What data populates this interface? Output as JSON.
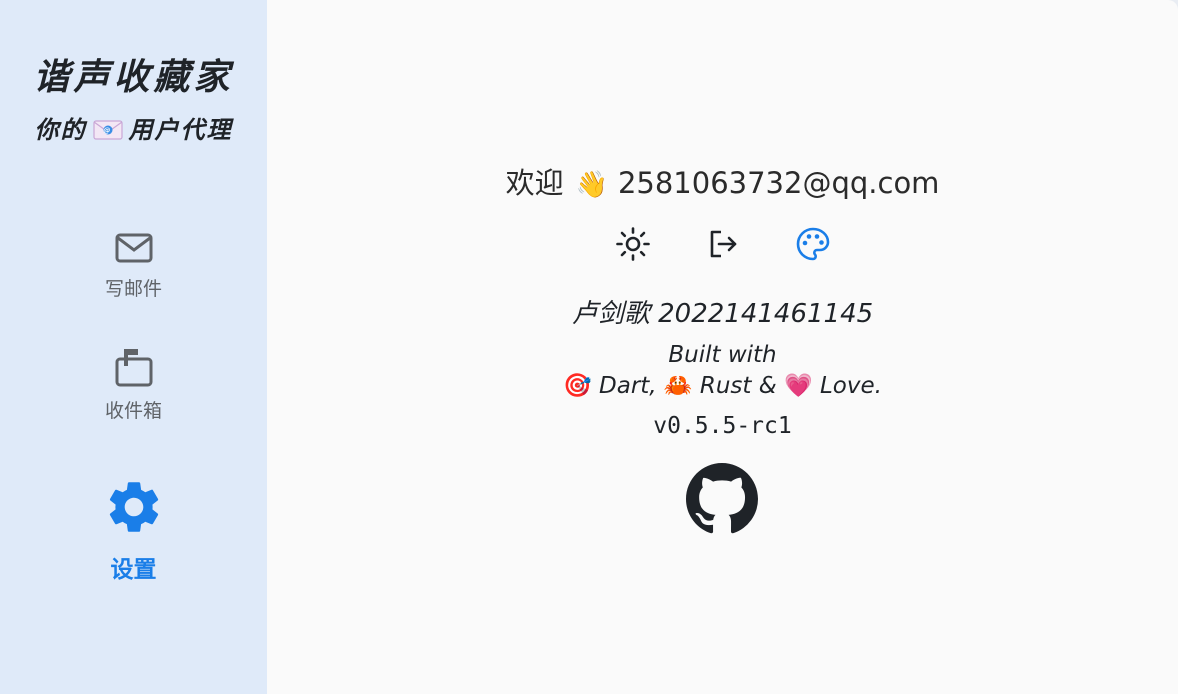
{
  "sidebar": {
    "app_title": "谐声收藏家",
    "subtitle_prefix": "你的",
    "subtitle_suffix": "用户代理",
    "subtitle_icon": "envelope-emoji",
    "items": [
      {
        "label": "写邮件",
        "icon": "mail-icon",
        "active": false
      },
      {
        "label": "收件箱",
        "icon": "inbox-icon",
        "active": false
      },
      {
        "label": "设置",
        "icon": "gear-icon",
        "active": true
      }
    ],
    "active_color": "#1a7ee8"
  },
  "main": {
    "welcome_prefix": "欢迎",
    "welcome_emoji": "👋",
    "email": "2581063732@qq.com",
    "actions": [
      {
        "icon": "brightness-icon"
      },
      {
        "icon": "logout-icon"
      },
      {
        "icon": "palette-icon",
        "color": "#1a7ee8"
      }
    ],
    "author": "卢剑歌 2022141461145",
    "built_with": "Built with",
    "tech_line": {
      "dart_emoji": "🎯",
      "dart": "Dart,",
      "rust_emoji": "🦀",
      "rust": "Rust &",
      "love_emoji": "💗",
      "love": "Love."
    },
    "version": "v0.5.5-rc1",
    "github_icon": "github-icon"
  }
}
